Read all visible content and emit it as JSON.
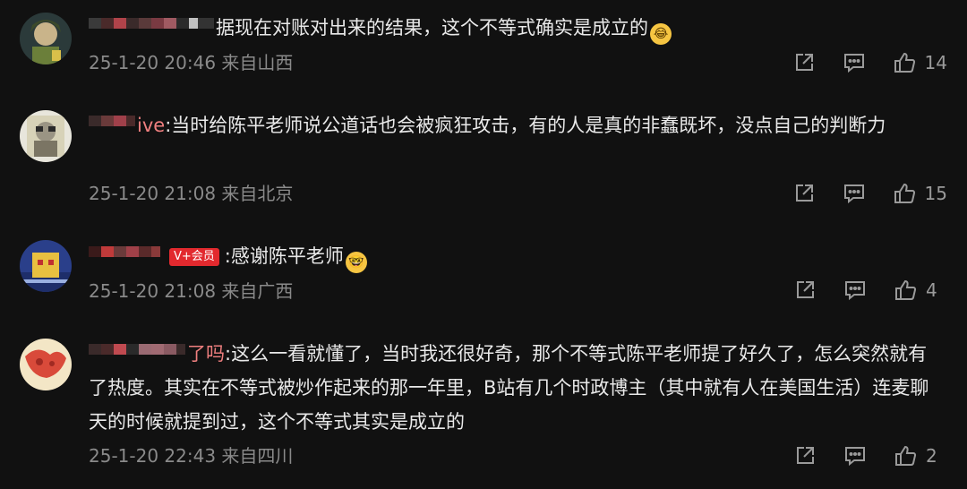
{
  "colors": {
    "background": "#111111",
    "text": "#e9e9e9",
    "meta": "#8a8a8a",
    "username": "#ef7f7f",
    "vip_badge": "#e2292e"
  },
  "comments": [
    {
      "username_visible": "",
      "text": "据现在对账对出来的结果，这个不等式确实是成立的",
      "emoji": "laughing-with-tears",
      "time": "25-1-20 20:46",
      "location": "来自山西",
      "likes": "14"
    },
    {
      "username_visible": "ive",
      "text": ":当时给陈平老师说公道话也会被疯狂攻击，有的人是真的非蠢既坏，没点自己的判断力",
      "time": "25-1-20 21:08",
      "location": "来自北京",
      "likes": "15"
    },
    {
      "username_visible": "",
      "vip_badge": "V+会员",
      "text": ":感谢陈平老师",
      "emoji": "nerd-glasses",
      "time": "25-1-20 21:08",
      "location": "来自广西",
      "likes": "4"
    },
    {
      "username_visible": "了吗",
      "text": ":这么一看就懂了，当时我还很好奇，那个不等式陈平老师提了好久了，怎么突然就有了热度。其实在不等式被炒作起来的那一年里，B站有几个时政博主（其中就有人在美国生活）连麦聊天的时候就提到过，这个不等式其实是成立的",
      "time": "25-1-20 22:43",
      "location": "来自四川",
      "likes": "2"
    }
  ]
}
